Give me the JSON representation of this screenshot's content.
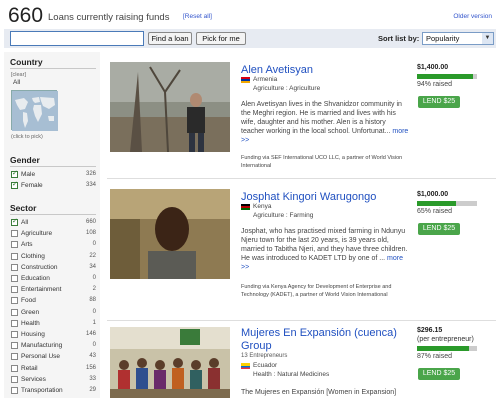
{
  "header": {
    "count": "660",
    "count_label": "Loans currently raising funds",
    "reset_label": "[Reset all]",
    "older_label": "Older version"
  },
  "search": {
    "value": "",
    "find_label": "Find a loan",
    "pick_label": "Pick for me",
    "sort_label": "Sort list by:",
    "sort_value": "Popularity"
  },
  "sidebar": {
    "country": {
      "title": "Country",
      "clear_label": "[clear]",
      "selected": "All",
      "map_hint": "(click to pick)"
    },
    "gender": {
      "title": "Gender",
      "items": [
        {
          "label": "Male",
          "count": "326",
          "checked": true
        },
        {
          "label": "Female",
          "count": "334",
          "checked": true
        }
      ]
    },
    "sector": {
      "title": "Sector",
      "items": [
        {
          "label": "All",
          "count": "660",
          "checked": true
        },
        {
          "label": "Agriculture",
          "count": "108",
          "checked": false
        },
        {
          "label": "Arts",
          "count": "0",
          "checked": false
        },
        {
          "label": "Clothing",
          "count": "22",
          "checked": false
        },
        {
          "label": "Construction",
          "count": "34",
          "checked": false
        },
        {
          "label": "Education",
          "count": "0",
          "checked": false
        },
        {
          "label": "Entertainment",
          "count": "2",
          "checked": false
        },
        {
          "label": "Food",
          "count": "88",
          "checked": false
        },
        {
          "label": "Green",
          "count": "0",
          "checked": false
        },
        {
          "label": "Health",
          "count": "1",
          "checked": false
        },
        {
          "label": "Housing",
          "count": "146",
          "checked": false
        },
        {
          "label": "Manufacturing",
          "count": "0",
          "checked": false
        },
        {
          "label": "Personal Use",
          "count": "43",
          "checked": false
        },
        {
          "label": "Retail",
          "count": "156",
          "checked": false
        },
        {
          "label": "Services",
          "count": "33",
          "checked": false
        },
        {
          "label": "Transportation",
          "count": "29",
          "checked": false
        }
      ]
    }
  },
  "loans": [
    {
      "name": "Alen Avetisyan",
      "country": "Armenia",
      "sector": "Agriculture : Agriculture",
      "description": "Alen Avetisyan lives in the Shvanidzor community in the Meghri region. He is married and lives with his wife, daughter and his mother. Alen is a history teacher working in the local school. Unfortunat...",
      "more_label": "more >>",
      "partner": "Funding via SEF International UCO LLC, a partner of World Vision International",
      "amount": "$1,400.00",
      "raised_pct": 94,
      "raised_label": "94% raised",
      "lend_label": "LEND $25"
    },
    {
      "name": "Josphat Kingori Warugongo",
      "country": "Kenya",
      "sector": "Agriculture : Farming",
      "description": "Josphat, who has practised mixed farming in Ndunyu Njeru town for the last 20 years, is 39 years old, married to Tabitha Njeri, and they have three children. He was introduced to KADET LTD by one of ...",
      "more_label": "more >>",
      "partner": "Funding via Kenya Agency for Development of Enterprise and Technology (KADET), a partner of World Vision International",
      "amount": "$1,000.00",
      "raised_pct": 65,
      "raised_label": "65% raised",
      "lend_label": "LEND $25"
    },
    {
      "name": "Mujeres En Expansión (cuenca) Group",
      "entrepreneurs": "13 Entrepreneurs",
      "country": "Ecuador",
      "sector": "Health : Natural Medicines",
      "description": "The Mujeres en Expansión [Women in Expansion]",
      "amount": "$296.15",
      "per_label": "(per entrepreneur)",
      "raised_pct": 87,
      "raised_label": "87% raised",
      "lend_label": "LEND $25"
    }
  ]
}
